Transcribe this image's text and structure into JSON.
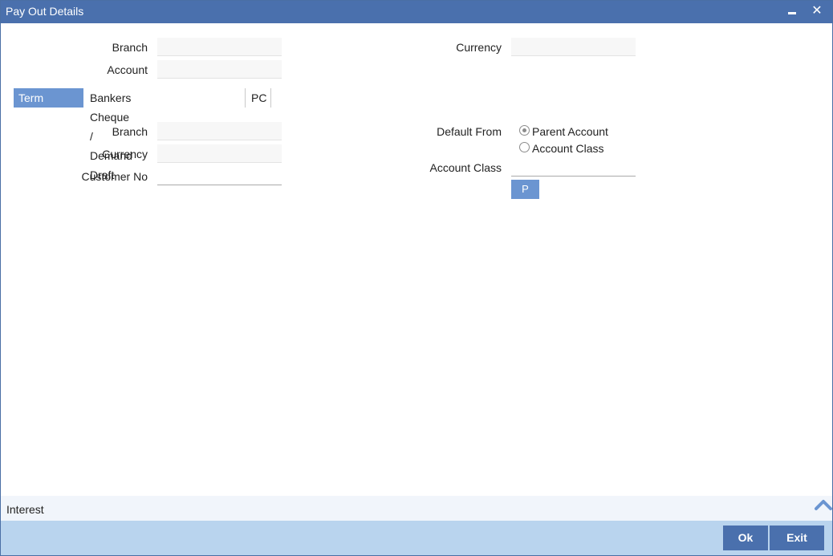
{
  "window": {
    "title": "Pay Out Details",
    "minimize_icon": "minimize-icon",
    "close_icon": "close-icon",
    "close_glyph": "✕"
  },
  "header": {
    "branch_label": "Branch",
    "branch_value": "",
    "account_label": "Account",
    "account_value": "",
    "currency_label": "Currency",
    "currency_value": ""
  },
  "tabs": [
    {
      "label": "Term deposit",
      "active": true
    },
    {
      "label": "Bankers Cheque / Demand Draft",
      "active": false
    },
    {
      "label": "PC",
      "active": false
    }
  ],
  "term_deposit": {
    "branch_label": "Branch",
    "branch_value": "",
    "currency_label": "Currency",
    "currency_value": "",
    "customer_no_label": "Customer No",
    "customer_no_value": "",
    "default_from_label": "Default From",
    "default_from_options": [
      {
        "label": "Parent Account",
        "checked": true
      },
      {
        "label": "Account Class",
        "checked": false
      }
    ],
    "account_class_label": "Account Class",
    "account_class_value": "",
    "p_button_label": "P"
  },
  "interest_section": {
    "label": "Interest",
    "toggle_icon": "chevron-up-icon"
  },
  "footer": {
    "ok_label": "Ok",
    "exit_label": "Exit"
  },
  "colors": {
    "titlebar": "#4a70ad",
    "active_tab": "#6b95d1",
    "footer": "#b9d4ee",
    "button": "#4a70ad"
  }
}
